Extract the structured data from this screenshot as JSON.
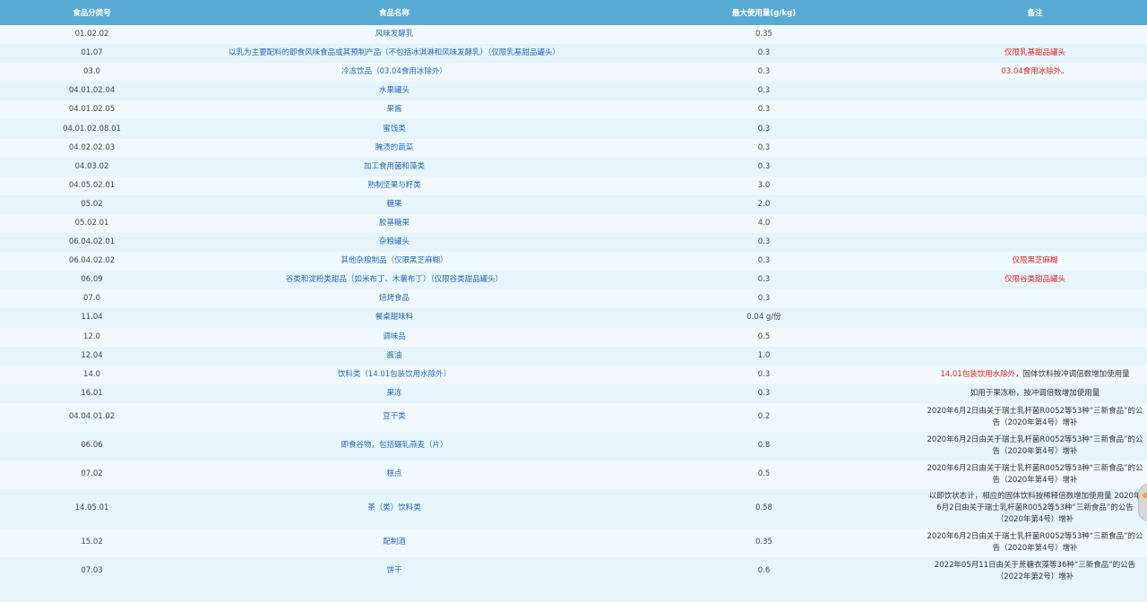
{
  "headers": [
    "食品分类号",
    "食品名称",
    "最大使用量(g/kg)",
    "备注"
  ],
  "rows": [
    {
      "code": "01.02.02",
      "name": "风味发酵乳",
      "amount": "0.35",
      "note": "",
      "note_red": ""
    },
    {
      "code": "01.07",
      "name": "以乳为主要配料的即食风味食品或其预制产品（不包括冰淇淋和风味发酵乳）（仅限乳基甜品罐头）",
      "amount": "0.3",
      "note": "",
      "note_red": "仅限乳基甜品罐头"
    },
    {
      "code": "03.0",
      "name": "冷冻饮品（03.04食用冰除外）",
      "amount": "0.3",
      "note": "",
      "note_red": "03.04食用冰除外。"
    },
    {
      "code": "04.01.02.04",
      "name": "水果罐头",
      "amount": "0.3",
      "note": "",
      "note_red": ""
    },
    {
      "code": "04.01.02.05",
      "name": "果酱",
      "amount": "0.3",
      "note": "",
      "note_red": ""
    },
    {
      "code": "04.01.02.08.01",
      "name": "蜜饯类",
      "amount": "0.3",
      "note": "",
      "note_red": ""
    },
    {
      "code": "04.02.02.03",
      "name": "腌渍的蔬菜",
      "amount": "0.3",
      "note": "",
      "note_red": ""
    },
    {
      "code": "04.03.02",
      "name": "加工食用菌和藻类",
      "amount": "0.3",
      "note": "",
      "note_red": ""
    },
    {
      "code": "04.05.02.01",
      "name": "熟制坚果与籽类",
      "amount": "3.0",
      "note": "",
      "note_red": ""
    },
    {
      "code": "05.02",
      "name": "糖果",
      "amount": "2.0",
      "note": "",
      "note_red": ""
    },
    {
      "code": "05.02.01",
      "name": "胶基糖果",
      "amount": "4.0",
      "note": "",
      "note_red": ""
    },
    {
      "code": "06.04.02.01",
      "name": "杂粮罐头",
      "amount": "0.3",
      "note": "",
      "note_red": ""
    },
    {
      "code": "06.04.02.02",
      "name": "其他杂粮制品（仅限黑芝麻糊）",
      "amount": "0.3",
      "note": "",
      "note_red": "仅限黑芝麻糊"
    },
    {
      "code": "06.09",
      "name": "谷类和淀粉类甜品（如米布丁、木薯布丁）（仅限谷类甜品罐头）",
      "amount": "0.3",
      "note": "",
      "note_red": "仅限谷类甜品罐头"
    },
    {
      "code": "07.0",
      "name": "焙烤食品",
      "amount": "0.3",
      "note": "",
      "note_red": ""
    },
    {
      "code": "11.04",
      "name": "餐桌甜味料",
      "amount": "0.04 g/份",
      "note": "",
      "note_red": ""
    },
    {
      "code": "12.0",
      "name": "调味品",
      "amount": "0.5",
      "note": "",
      "note_red": ""
    },
    {
      "code": "12.04",
      "name": "酱油",
      "amount": "1.0",
      "note": "",
      "note_red": ""
    },
    {
      "code": "14.0",
      "name": "饮料类（14.01包装饮用水除外）",
      "amount": "0.3",
      "note": "，固体饮料按冲调倍数增加使用量",
      "note_red": "14.01包装饮用水除外"
    },
    {
      "code": "16.01",
      "name": "果冻",
      "amount": "0.3",
      "note": "如用于果冻粉，按冲调倍数增加使用量",
      "note_red": ""
    },
    {
      "code": "04.04.01.02",
      "name": "豆干类",
      "amount": "0.2",
      "note": "2020年6月2日由关于瑞士乳杆菌R0052等53种“三新食品”的公告（2020年第4号）增补",
      "note_red": ""
    },
    {
      "code": "06.06",
      "name": "即食谷物，包括碾轧燕麦（片）",
      "amount": "0.8",
      "note": "2020年6月2日由关于瑞士乳杆菌R0052等53种“三新食品”的公告（2020年第4号）增补",
      "note_red": ""
    },
    {
      "code": "07.02",
      "name": "糕点",
      "amount": "0.5",
      "note": "2020年6月2日由关于瑞士乳杆菌R0052等53种“三新食品”的公告（2020年第4号）增补",
      "note_red": ""
    },
    {
      "code": "14.05.01",
      "name": "茶（类）饮料类",
      "amount": "0.58",
      "note": "以即饮状态计，相应的固体饮料按稀释倍数增加使用量 2020年6月2日由关于瑞士乳杆菌R0052等53种“三新食品”的公告（2020年第4号）增补",
      "note_red": ""
    },
    {
      "code": "15.02",
      "name": "配制酒",
      "amount": "0.35",
      "note": "2020年6月2日由关于瑞士乳杆菌R0052等53种“三新食品”的公告（2020年第4号）增补",
      "note_red": ""
    },
    {
      "code": "07.03",
      "name": "饼干",
      "amount": "0.6",
      "note": "2022年05月11日由关于蔗糖衣藻等36种“三新食品”的公告（2022年第2号）增补",
      "note_red": ""
    }
  ]
}
